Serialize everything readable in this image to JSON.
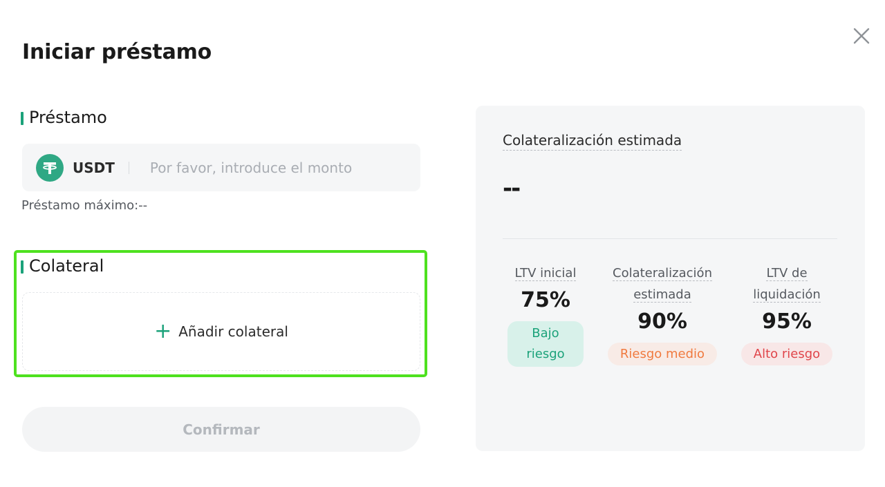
{
  "modal": {
    "title": "Iniciar préstamo",
    "close_icon": "close-icon"
  },
  "loan": {
    "section_label": "Préstamo",
    "coin_icon": "tether-icon",
    "coin_symbol": "USDT",
    "amount_value": "",
    "amount_placeholder": "Por favor, introduce el monto",
    "max_loan_text": "Préstamo máximo:--"
  },
  "collateral": {
    "section_label": "Colateral",
    "add_icon": "plus-icon",
    "add_label": "Añadir colateral"
  },
  "confirm_label": "Confirmar",
  "summary": {
    "estimated_label": "Colateralización estimada",
    "estimated_value": "--",
    "metrics": [
      {
        "label_line1": "LTV inicial",
        "label_line2": "",
        "value": "75%",
        "badge": "Bajo riesgo",
        "badge_color": "#1ba27a"
      },
      {
        "label_line1": "Colateralización",
        "label_line2": "estimada",
        "value": "90%",
        "badge": "Riesgo medio",
        "badge_color": "#f07a3f"
      },
      {
        "label_line1": "LTV de",
        "label_line2": "liquidación",
        "value": "95%",
        "badge": "Alto riesgo",
        "badge_color": "#e0454a"
      }
    ]
  },
  "colors": {
    "accent": "#1ba27a",
    "highlight_border": "#4ee11f",
    "panel_bg": "#f5f6f7"
  }
}
